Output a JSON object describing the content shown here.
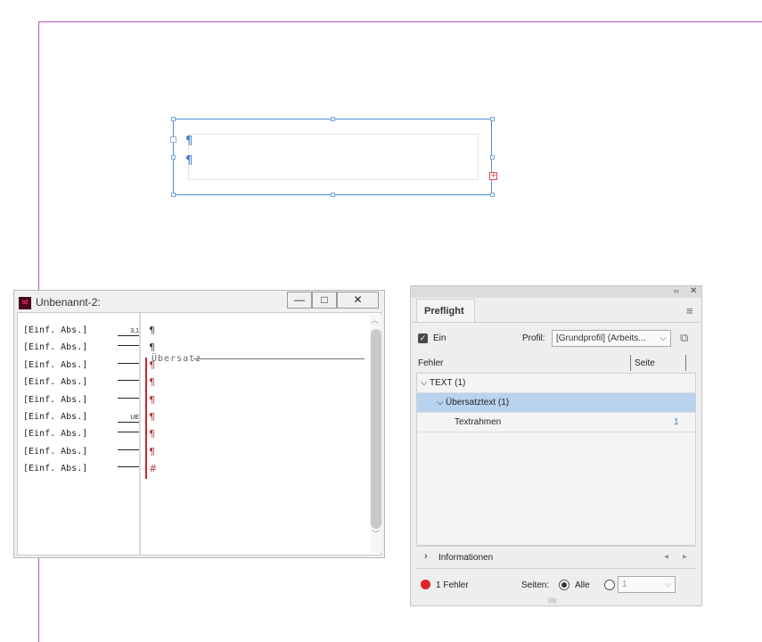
{
  "editor": {
    "title": "Unbenannt-2:",
    "rows": [
      {
        "label": "[Einf. Abs.]",
        "depth": "3,1",
        "mark": "¶"
      },
      {
        "label": "[Einf. Abs.]",
        "depth": "",
        "mark": "¶"
      },
      {
        "label": "[Einf. Abs.]",
        "depth": "",
        "mark": "¶"
      },
      {
        "label": "[Einf. Abs.]",
        "depth": "",
        "mark": "¶"
      },
      {
        "label": "[Einf. Abs.]",
        "depth": "",
        "mark": "¶"
      },
      {
        "label": "[Einf. Abs.]",
        "depth": "UE",
        "mark": "¶"
      },
      {
        "label": "[Einf. Abs.]",
        "depth": "",
        "mark": "¶"
      },
      {
        "label": "[Einf. Abs.]",
        "depth": "",
        "mark": "¶"
      },
      {
        "label": "[Einf. Abs.]",
        "depth": "",
        "mark": "#"
      }
    ],
    "overset_label": "Übersatz",
    "buttons": {
      "minimize": "—",
      "maximize": "□",
      "close": "✕"
    }
  },
  "frame": {
    "pilcrows": [
      "¶",
      "¶"
    ],
    "overset_symbol": "+"
  },
  "preflight": {
    "tab": "Preflight",
    "on_label": "Ein",
    "on_checked": true,
    "profile_label": "Profil:",
    "profile_value": "[Grundprofil] (Arbeits...",
    "col_error": "Fehler",
    "col_page": "Seite",
    "tree": [
      {
        "label": "TEXT (1)",
        "indent": 0,
        "expanded": true,
        "page": ""
      },
      {
        "label": "Übersatztext (1)",
        "indent": 1,
        "expanded": true,
        "selected": true,
        "page": ""
      },
      {
        "label": "Textrahmen",
        "indent": 2,
        "page": "1"
      }
    ],
    "info_label": "Informationen",
    "status": "1 Fehler",
    "status_color": "#e0242b",
    "pages_label": "Seiten:",
    "pages_all": "Alle",
    "pages_range": "1"
  },
  "icons": {
    "menu": "hamburger-icon",
    "collapse": "double-chevron-left-icon",
    "close": "close-icon"
  }
}
